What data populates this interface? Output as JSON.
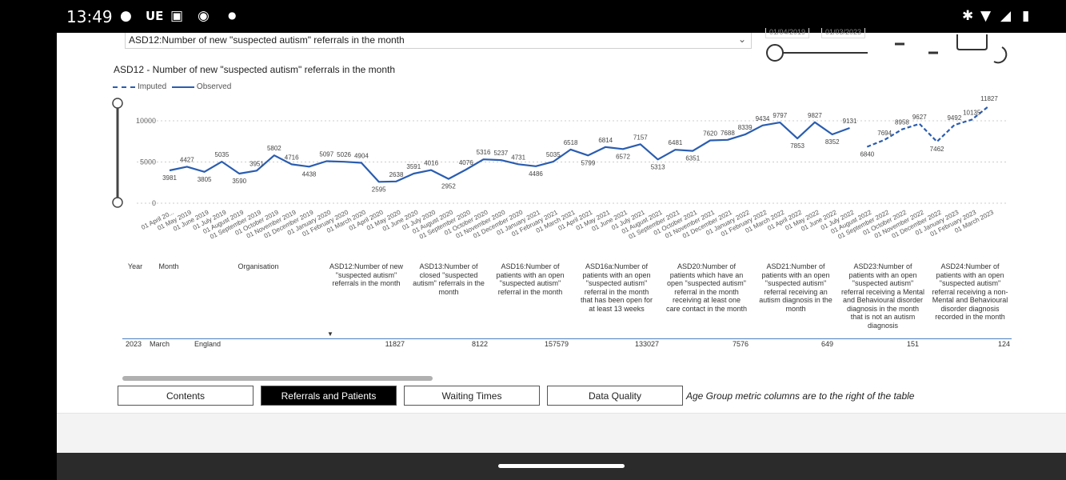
{
  "status_bar": {
    "time": "13:49",
    "notif_text": "UE"
  },
  "filter": {
    "selected": "ASD12:Number of new \"suspected autism\" referrals in the month"
  },
  "date_range": {
    "start": "01/04/2019",
    "end": "01/03/2023"
  },
  "chart": {
    "title": "ASD12 - Number of new \"suspected autism\" referrals in the month",
    "legend": {
      "imputed": "Imputed",
      "observed": "Observed"
    }
  },
  "chart_data": {
    "type": "line",
    "title": "ASD12 - Number of new \"suspected autism\" referrals in the month",
    "ylim": [
      0,
      11000
    ],
    "yticks": [
      0,
      5000,
      10000
    ],
    "grid": true,
    "legend_position": "top-left",
    "categories": [
      "01 April 2019",
      "01 May 2019",
      "01 June 2019",
      "01 July 2019",
      "01 August 2019",
      "01 September 2019",
      "01 October 2019",
      "01 November 2019",
      "01 December 2019",
      "01 January 2020",
      "01 February 2020",
      "01 March 2020",
      "01 April 2020",
      "01 May 2020",
      "01 June 2020",
      "01 July 2020",
      "01 August 2020",
      "01 September 2020",
      "01 October 2020",
      "01 November 2020",
      "01 December 2020",
      "01 January 2021",
      "01 February 2021",
      "01 March 2021",
      "01 April 2021",
      "01 May 2021",
      "01 June 2021",
      "01 July 2021",
      "01 August 2021",
      "01 September 2021",
      "01 October 2021",
      "01 November 2021",
      "01 December 2021",
      "01 January 2022",
      "01 February 2022",
      "01 March 2022",
      "01 April 2022",
      "01 May 2022",
      "01 June 2022",
      "01 July 2022",
      "01 August 2022",
      "01 September 2022",
      "01 October 2022",
      "01 November 2022",
      "01 December 2022",
      "01 January 2023",
      "01 February 2023",
      "01 March 2023"
    ],
    "tick_labels": [
      "01 April 20...",
      "01 May 2019",
      "01 June 2019",
      "01 July 2019",
      "01 August 2019",
      "01 September 2019",
      "01 October 2019",
      "01 November 2019",
      "01 December 2019",
      "01 January 2020",
      "01 February 2020",
      "01 March 2020",
      "01 April 2020",
      "01 May 2020",
      "01 June 2020",
      "01 July 2020",
      "01 August 2020",
      "01 September 2020",
      "01 October 2020",
      "01 November 2020",
      "01 December 2020",
      "01 January 2021",
      "01 February 2021",
      "01 March 2021",
      "01 April 2021",
      "01 May 2021",
      "01 June 2021",
      "01 July 2021",
      "01 August 2021",
      "01 September 2021",
      "01 October 2021",
      "01 November 2021",
      "01 December 2021",
      "01 January 2022",
      "01 February 2022",
      "01 March 2022",
      "01 April 2022",
      "01 May 2022",
      "01 June 2022",
      "01 July 2022",
      "01 August 2022",
      "01 September 2022",
      "01 October 2022",
      "01 November 2022",
      "01 December 2022",
      "01 January 2023",
      "01 February 2023",
      "01 March 2023"
    ],
    "series": [
      {
        "name": "Observed",
        "style": "solid",
        "color": "#2a5db0",
        "values": [
          3981,
          4427,
          3805,
          5035,
          3590,
          3951,
          5802,
          4716,
          4438,
          5097,
          5026,
          4904,
          2595,
          2638,
          3591,
          4016,
          2952,
          4076,
          5316,
          5237,
          4731,
          4486,
          5035,
          6518,
          5799,
          6814,
          6572,
          7157,
          5313,
          6481,
          6351,
          7620,
          7688,
          8339,
          9434,
          9797,
          7853,
          9827,
          8352,
          9131,
          null,
          null,
          null,
          null,
          null,
          null,
          null,
          null
        ]
      },
      {
        "name": "Imputed",
        "style": "dashed",
        "color": "#2a5db0",
        "values": [
          null,
          null,
          null,
          null,
          null,
          null,
          null,
          null,
          null,
          null,
          null,
          null,
          null,
          null,
          null,
          null,
          null,
          null,
          null,
          null,
          null,
          null,
          null,
          null,
          null,
          null,
          null,
          null,
          null,
          null,
          null,
          null,
          null,
          null,
          null,
          null,
          null,
          null,
          null,
          null,
          6840,
          7694,
          8958,
          9627,
          7462,
          9492,
          10135,
          11827
        ]
      }
    ]
  },
  "table": {
    "columns": [
      {
        "label": "Year"
      },
      {
        "label": "Month"
      },
      {
        "label": "Organisation"
      },
      {
        "label": "ASD12:Number of new \"suspected autism\" referrals in the month"
      },
      {
        "label": "ASD13:Number of closed \"suspected autism\" referrals in the month"
      },
      {
        "label": "ASD16:Number of patients with an open \"suspected autism\" referral in the month"
      },
      {
        "label": "ASD16a:Number of patients with an open \"suspected autism\" referral in the month that has been open for at least 13 weeks"
      },
      {
        "label": "ASD20:Number of patients which have an open \"suspected autism\" referral in the month receiving at least one care contact in the month"
      },
      {
        "label": "ASD21:Number of patients with an open \"suspected autism\" referral receiving an autism diagnosis in the month"
      },
      {
        "label": "ASD23:Number of patients with an open \"suspected autism\" referral receiving a Mental and Behavioural disorder diagnosis in the month that is not an autism diagnosis"
      },
      {
        "label": "ASD24:Number of patients with an open \"suspected autism\" referral receiving a non-Mental and Behavioural disorder diagnosis recorded in the month"
      }
    ],
    "rows": [
      [
        "2023",
        "March",
        "England",
        "11827",
        "8122",
        "157579",
        "133027",
        "7576",
        "649",
        "151",
        "124"
      ]
    ]
  },
  "tabs": [
    {
      "label": "Contents",
      "active": false
    },
    {
      "label": "Referrals and Patients",
      "active": true
    },
    {
      "label": "Waiting Times",
      "active": false
    },
    {
      "label": "Data Quality",
      "active": false
    }
  ],
  "note": "Age Group metric columns are to the right of the table"
}
